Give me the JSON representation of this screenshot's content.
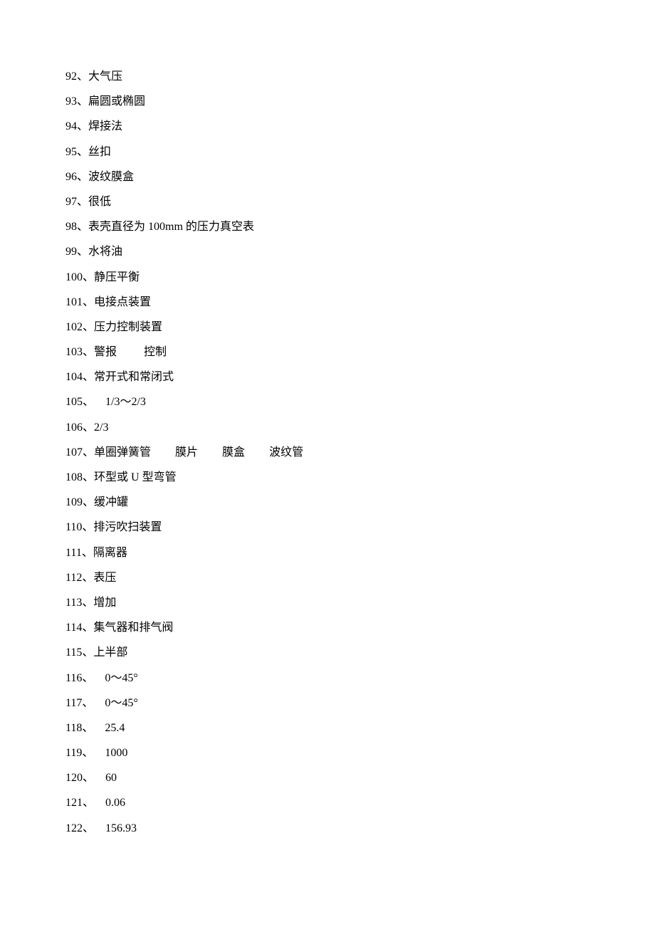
{
  "items": [
    {
      "num": "92",
      "sep": "、",
      "text": "大气压"
    },
    {
      "num": "93",
      "sep": "、",
      "text": "扁圆或椭圆"
    },
    {
      "num": "94",
      "sep": "、",
      "text": "焊接法"
    },
    {
      "num": "95",
      "sep": "、",
      "text": "丝扣"
    },
    {
      "num": "96",
      "sep": "、",
      "text": "波纹膜盒"
    },
    {
      "num": "97",
      "sep": "、",
      "text": "很低"
    },
    {
      "num": "98",
      "sep": "、",
      "text": "表壳直径为 100mm 的压力真空表"
    },
    {
      "num": "99",
      "sep": "、",
      "text": "水将油"
    },
    {
      "num": "100",
      "sep": "、",
      "text": "静压平衡"
    },
    {
      "num": "101",
      "sep": "、",
      "text": "电接点装置"
    },
    {
      "num": "102",
      "sep": "、",
      "text": "压力控制装置"
    },
    {
      "num": "103",
      "sep": "、",
      "parts": [
        "警报",
        "控制"
      ],
      "gap": "gap-mid"
    },
    {
      "num": "104",
      "sep": "、",
      "text": "常开式和常闭式"
    },
    {
      "num": "105",
      "sep": "、",
      "pre": " ",
      "text": "1/3～2/3"
    },
    {
      "num": "106",
      "sep": "、",
      "text": "2/3"
    },
    {
      "num": "107",
      "sep": "、",
      "parts": [
        "单圈弹簧管",
        "膜片",
        "膜盒",
        "波纹管"
      ],
      "gap": "gap-large"
    },
    {
      "num": "108",
      "sep": "、",
      "text": "环型或 U 型弯管"
    },
    {
      "num": "109",
      "sep": "、",
      "text": "缓冲罐"
    },
    {
      "num": "110",
      "sep": "、",
      "text": "排污吹扫装置"
    },
    {
      "num": "111",
      "sep": "、",
      "text": "隔离器"
    },
    {
      "num": "112",
      "sep": "、",
      "text": "表压"
    },
    {
      "num": "113",
      "sep": "、",
      "text": "增加"
    },
    {
      "num": "114",
      "sep": "、",
      "text": "集气器和排气阀"
    },
    {
      "num": "115",
      "sep": "、",
      "text": "上半部"
    },
    {
      "num": "116",
      "sep": "、",
      "pre": " ",
      "text": "0～45°"
    },
    {
      "num": "117",
      "sep": "、",
      "pre": " ",
      "text": "0～45°"
    },
    {
      "num": "118",
      "sep": "、",
      "pre": " ",
      "text": "25.4"
    },
    {
      "num": "119",
      "sep": "、",
      "pre": " ",
      "text": "1000"
    },
    {
      "num": "120",
      "sep": "、",
      "pre": " ",
      "text": "60"
    },
    {
      "num": "121",
      "sep": "、",
      "pre": " ",
      "text": "0.06"
    },
    {
      "num": "122",
      "sep": "、",
      "pre": " ",
      "text": "156.93"
    }
  ]
}
